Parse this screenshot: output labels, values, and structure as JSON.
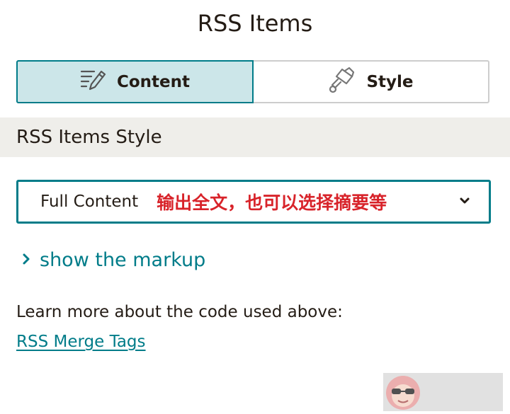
{
  "header": {
    "title": "RSS Items"
  },
  "tabs": [
    {
      "label": "Content",
      "icon": "edit-lines-icon",
      "active": true
    },
    {
      "label": "Style",
      "icon": "paint-roller-icon",
      "active": false
    }
  ],
  "section": {
    "title": "RSS Items Style"
  },
  "select": {
    "value": "Full Content",
    "annotation": "输出全文，也可以选择摘要等",
    "icon": "chevron-down-icon"
  },
  "markup": {
    "label": "show the markup",
    "icon": "chevron-right-icon"
  },
  "learn": {
    "text": "Learn more about the code used above:",
    "link_label": "RSS Merge Tags"
  },
  "colors": {
    "accent": "#007c89",
    "active_tab_bg": "#cce6e9",
    "section_bg": "#efeeea",
    "annotation": "#d8232a",
    "text": "#241c15"
  }
}
